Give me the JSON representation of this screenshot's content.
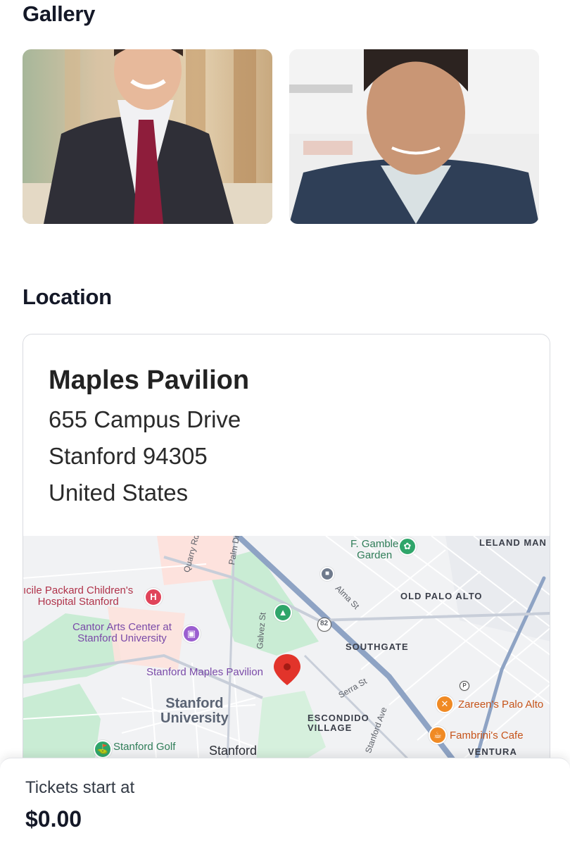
{
  "gallery": {
    "title": "Gallery",
    "photos": [
      {
        "name": "gallery-photo-1"
      },
      {
        "name": "gallery-photo-2"
      }
    ]
  },
  "location": {
    "title": "Location",
    "venue_name": "Maples Pavilion",
    "address_lines": [
      "655 Campus Drive",
      "Stanford 94305",
      "United States"
    ]
  },
  "map": {
    "labels": {
      "gamble_garden": "Elizabeth\nF. Gamble\nGarden",
      "leland_manor": "LELAND MAN",
      "childrens_hospital": "ıcile Packard Children's\nHospital Stanford",
      "cantor": "Cantor Arts Center at\nStanford University",
      "old_palo_alto": "OLD PALO ALTO",
      "southgate": "SOUTHGATE",
      "maples_pavilion": "Stanford Maples Pavilion",
      "stanford_university": "Stanford\nUniversity",
      "escondido_village": "ESCONDIDO\nVILLAGE",
      "zareens": "Zareen's Palo Alto",
      "fambrinis": "Fambrini's Cafe",
      "ventura": "VENTURA",
      "stanford_golf": "Stanford Golf",
      "stanford_town": "Stanford",
      "quarry_rd": "Quarry Rd",
      "palm_dr": "Palm Dr",
      "galvez_st": "Galvez St",
      "alma_st": "Alma St",
      "serra_st": "Serra St",
      "stanford_ave": "Stanford Ave",
      "route_82": "82"
    },
    "colors": {
      "park": "#c9ecd4",
      "road_major": "#8ea3c4",
      "pin": "#e2342b"
    }
  },
  "tickets": {
    "label": "Tickets start at",
    "price": "$0.00"
  }
}
